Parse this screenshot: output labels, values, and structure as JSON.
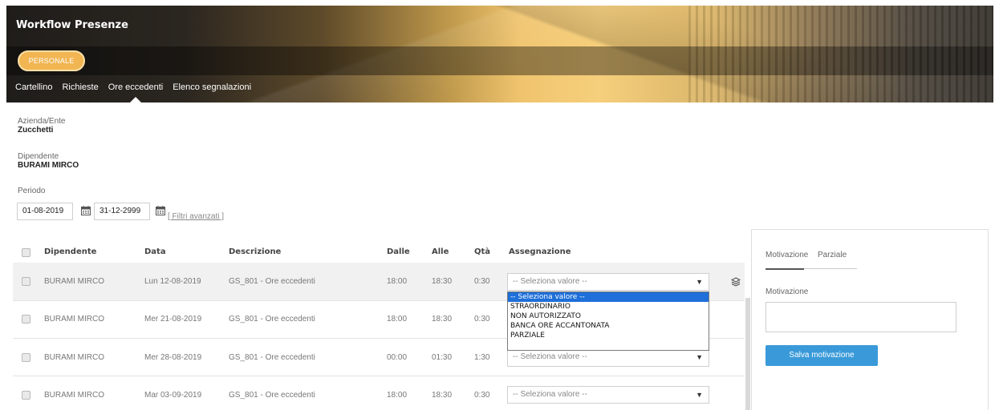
{
  "header": {
    "title": "Workflow Presenze",
    "profile": "PERSONALE",
    "nav": [
      "Cartellino",
      "Richieste",
      "Ore eccedenti",
      "Elenco segnalazioni"
    ],
    "active_nav": "Ore eccedenti"
  },
  "info": {
    "company_label": "Azienda/Ente",
    "company_value": "Zucchetti",
    "employee_label": "Dipendente",
    "employee_value": "BURAMI MIRCO",
    "period_label": "Periodo",
    "date_from": "01-08-2019",
    "date_to": "31-12-2999",
    "filters_link": "[ Filtri avanzati ]"
  },
  "table": {
    "columns": [
      "Dipendente",
      "Data",
      "Descrizione",
      "Dalle",
      "Alle",
      "Qtà",
      "Assegnazione"
    ],
    "rows": [
      {
        "employee": "BURAMI MIRCO",
        "date": "Lun 12-08-2019",
        "description": "GS_801 - Ore eccedenti",
        "from": "18:00",
        "to": "18:30",
        "qty": "0:30",
        "assignment": "-- Seleziona valore --"
      },
      {
        "employee": "BURAMI MIRCO",
        "date": "Mer 21-08-2019",
        "description": "GS_801 - Ore eccedenti",
        "from": "18:00",
        "to": "18:30",
        "qty": "0:30",
        "assignment": ""
      },
      {
        "employee": "BURAMI MIRCO",
        "date": "Mer 28-08-2019",
        "description": "GS_801 - Ore eccedenti",
        "from": "00:00",
        "to": "01:30",
        "qty": "1:30",
        "assignment": "-- Seleziona valore --"
      },
      {
        "employee": "BURAMI MIRCO",
        "date": "Mar 03-09-2019",
        "description": "GS_801 - Ore eccedenti",
        "from": "18:00",
        "to": "18:30",
        "qty": "0:30",
        "assignment": "-- Seleziona valore --"
      }
    ],
    "dropdown_options": [
      "-- Seleziona valore --",
      "STRAORDINARIO",
      "NON AUTORIZZATO",
      "BANCA ORE ACCANTONATA",
      "PARZIALE"
    ],
    "dropdown_selected": "-- Seleziona valore --"
  },
  "panel": {
    "tabs": [
      "Motivazione",
      "Parziale"
    ],
    "active_tab": "Motivazione",
    "field_label": "Motivazione",
    "field_value": "",
    "save_label": "Salva motivazione"
  },
  "colors": {
    "accent": "#3a9ad9",
    "profile_pill": "#f1b552",
    "dropdown_highlight": "#1e6fd9"
  }
}
